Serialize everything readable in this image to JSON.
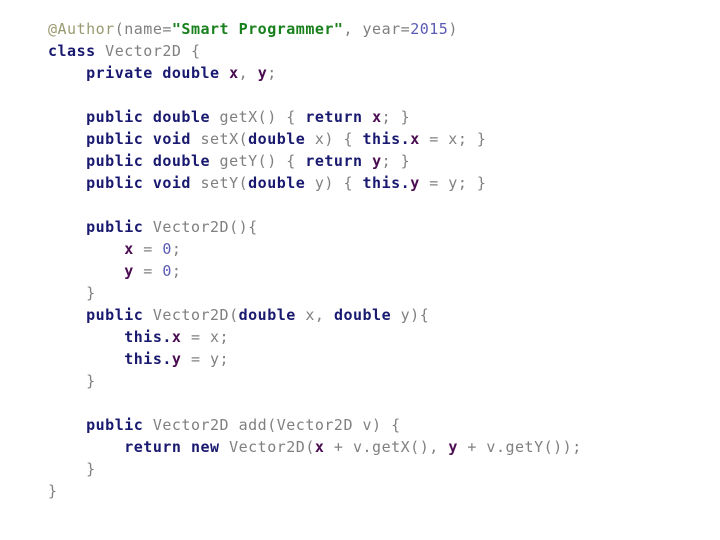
{
  "document": {
    "language": "Java",
    "class_name": "Vector2D",
    "background_color": "#ffffff"
  },
  "syntax_colors": {
    "plain": "#808080",
    "keyword": "#191970",
    "field": "#4b0d52",
    "string": "#18801c",
    "number": "#5a5ab4",
    "annotation": "#9a9a72"
  },
  "code": {
    "lines": [
      {
        "indent": 0,
        "tokens": [
          {
            "t": "annotation",
            "v": "@Author"
          },
          {
            "t": "plain",
            "v": "(name="
          },
          {
            "t": "string",
            "v": "\"Smart Programmer\""
          },
          {
            "t": "plain",
            "v": ", year="
          },
          {
            "t": "number",
            "v": "2015"
          },
          {
            "t": "plain",
            "v": ")"
          }
        ]
      },
      {
        "indent": 0,
        "tokens": [
          {
            "t": "keyword",
            "v": "class"
          },
          {
            "t": "plain",
            "v": " Vector2D {"
          }
        ]
      },
      {
        "indent": 1,
        "tokens": [
          {
            "t": "keyword",
            "v": "private double"
          },
          {
            "t": "plain",
            "v": " "
          },
          {
            "t": "field",
            "v": "x"
          },
          {
            "t": "plain",
            "v": ", "
          },
          {
            "t": "field",
            "v": "y"
          },
          {
            "t": "plain",
            "v": ";"
          }
        ]
      },
      {
        "indent": 0,
        "tokens": []
      },
      {
        "indent": 1,
        "tokens": [
          {
            "t": "keyword",
            "v": "public double"
          },
          {
            "t": "plain",
            "v": " getX() { "
          },
          {
            "t": "keyword",
            "v": "return"
          },
          {
            "t": "plain",
            "v": " "
          },
          {
            "t": "field",
            "v": "x"
          },
          {
            "t": "plain",
            "v": "; }"
          }
        ]
      },
      {
        "indent": 1,
        "tokens": [
          {
            "t": "keyword",
            "v": "public void"
          },
          {
            "t": "plain",
            "v": " setX("
          },
          {
            "t": "keyword",
            "v": "double"
          },
          {
            "t": "plain",
            "v": " x) { "
          },
          {
            "t": "keyword",
            "v": "this."
          },
          {
            "t": "field",
            "v": "x"
          },
          {
            "t": "plain",
            "v": " = x; }"
          }
        ]
      },
      {
        "indent": 1,
        "tokens": [
          {
            "t": "keyword",
            "v": "public double"
          },
          {
            "t": "plain",
            "v": " getY() { "
          },
          {
            "t": "keyword",
            "v": "return"
          },
          {
            "t": "plain",
            "v": " "
          },
          {
            "t": "field",
            "v": "y"
          },
          {
            "t": "plain",
            "v": "; }"
          }
        ]
      },
      {
        "indent": 1,
        "tokens": [
          {
            "t": "keyword",
            "v": "public void"
          },
          {
            "t": "plain",
            "v": " setY("
          },
          {
            "t": "keyword",
            "v": "double"
          },
          {
            "t": "plain",
            "v": " y) { "
          },
          {
            "t": "keyword",
            "v": "this."
          },
          {
            "t": "field",
            "v": "y"
          },
          {
            "t": "plain",
            "v": " = y; }"
          }
        ]
      },
      {
        "indent": 0,
        "tokens": []
      },
      {
        "indent": 1,
        "tokens": [
          {
            "t": "keyword",
            "v": "public"
          },
          {
            "t": "plain",
            "v": " Vector2D(){"
          }
        ]
      },
      {
        "indent": 2,
        "tokens": [
          {
            "t": "field",
            "v": "x"
          },
          {
            "t": "plain",
            "v": " = "
          },
          {
            "t": "number",
            "v": "0"
          },
          {
            "t": "plain",
            "v": ";"
          }
        ]
      },
      {
        "indent": 2,
        "tokens": [
          {
            "t": "field",
            "v": "y"
          },
          {
            "t": "plain",
            "v": " = "
          },
          {
            "t": "number",
            "v": "0"
          },
          {
            "t": "plain",
            "v": ";"
          }
        ]
      },
      {
        "indent": 1,
        "tokens": [
          {
            "t": "plain",
            "v": "}"
          }
        ]
      },
      {
        "indent": 1,
        "tokens": [
          {
            "t": "keyword",
            "v": "public"
          },
          {
            "t": "plain",
            "v": " Vector2D("
          },
          {
            "t": "keyword",
            "v": "double"
          },
          {
            "t": "plain",
            "v": " x, "
          },
          {
            "t": "keyword",
            "v": "double"
          },
          {
            "t": "plain",
            "v": " y){"
          }
        ]
      },
      {
        "indent": 2,
        "tokens": [
          {
            "t": "keyword",
            "v": "this."
          },
          {
            "t": "field",
            "v": "x"
          },
          {
            "t": "plain",
            "v": " = x;"
          }
        ]
      },
      {
        "indent": 2,
        "tokens": [
          {
            "t": "keyword",
            "v": "this."
          },
          {
            "t": "field",
            "v": "y"
          },
          {
            "t": "plain",
            "v": " = y;"
          }
        ]
      },
      {
        "indent": 1,
        "tokens": [
          {
            "t": "plain",
            "v": "}"
          }
        ]
      },
      {
        "indent": 0,
        "tokens": []
      },
      {
        "indent": 1,
        "tokens": [
          {
            "t": "keyword",
            "v": "public"
          },
          {
            "t": "plain",
            "v": " Vector2D add(Vector2D v) {"
          }
        ]
      },
      {
        "indent": 2,
        "tokens": [
          {
            "t": "keyword",
            "v": "return new"
          },
          {
            "t": "plain",
            "v": " Vector2D("
          },
          {
            "t": "field",
            "v": "x"
          },
          {
            "t": "plain",
            "v": " + v.getX(), "
          },
          {
            "t": "field",
            "v": "y"
          },
          {
            "t": "plain",
            "v": " + v.getY());"
          }
        ]
      },
      {
        "indent": 1,
        "tokens": [
          {
            "t": "plain",
            "v": "}"
          }
        ]
      },
      {
        "indent": 0,
        "tokens": [
          {
            "t": "plain",
            "v": "}"
          }
        ]
      }
    ]
  }
}
